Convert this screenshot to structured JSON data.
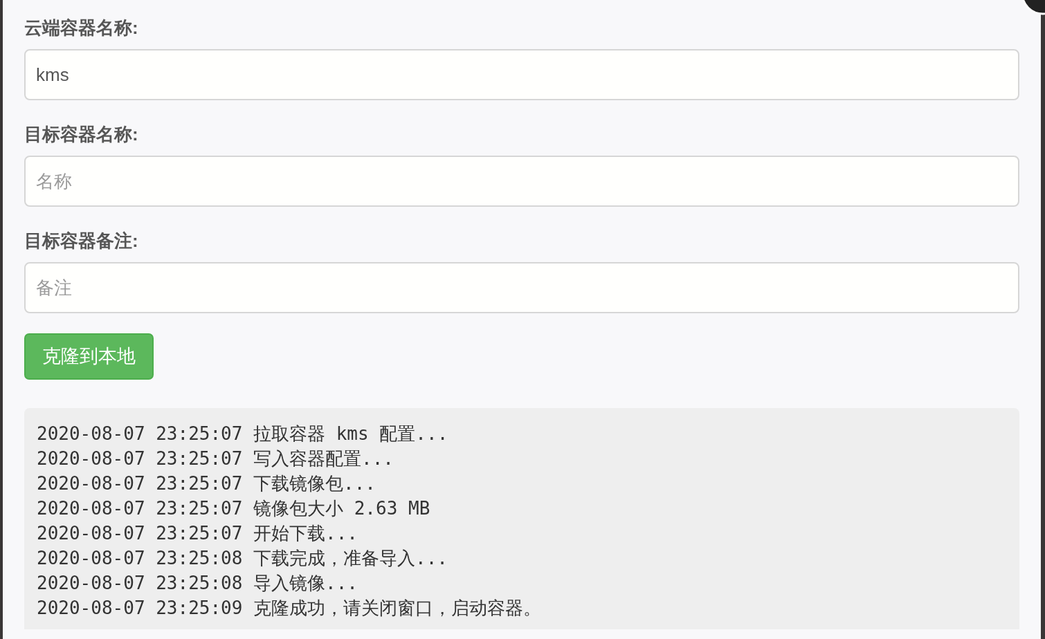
{
  "fields": [
    {
      "label": "云端容器名称:",
      "value": "kms"
    },
    {
      "label": "目标容器名称:",
      "placeholder": "名称"
    },
    {
      "label": "目标容器备注:",
      "placeholder": "备注"
    }
  ],
  "clone_button": {
    "label": "克隆到本地"
  },
  "log_lines": [
    "2020-08-07 23:25:07 拉取容器 kms 配置...",
    "2020-08-07 23:25:07 写入容器配置...",
    "2020-08-07 23:25:07 下载镜像包...",
    "2020-08-07 23:25:07 镜像包大小 2.63 MB",
    "2020-08-07 23:25:07 开始下载...",
    "2020-08-07 23:25:08 下载完成，准备导入...",
    "2020-08-07 23:25:08 导入镜像...",
    "2020-08-07 23:25:09 克隆成功，请关闭窗口，启动容器。"
  ]
}
